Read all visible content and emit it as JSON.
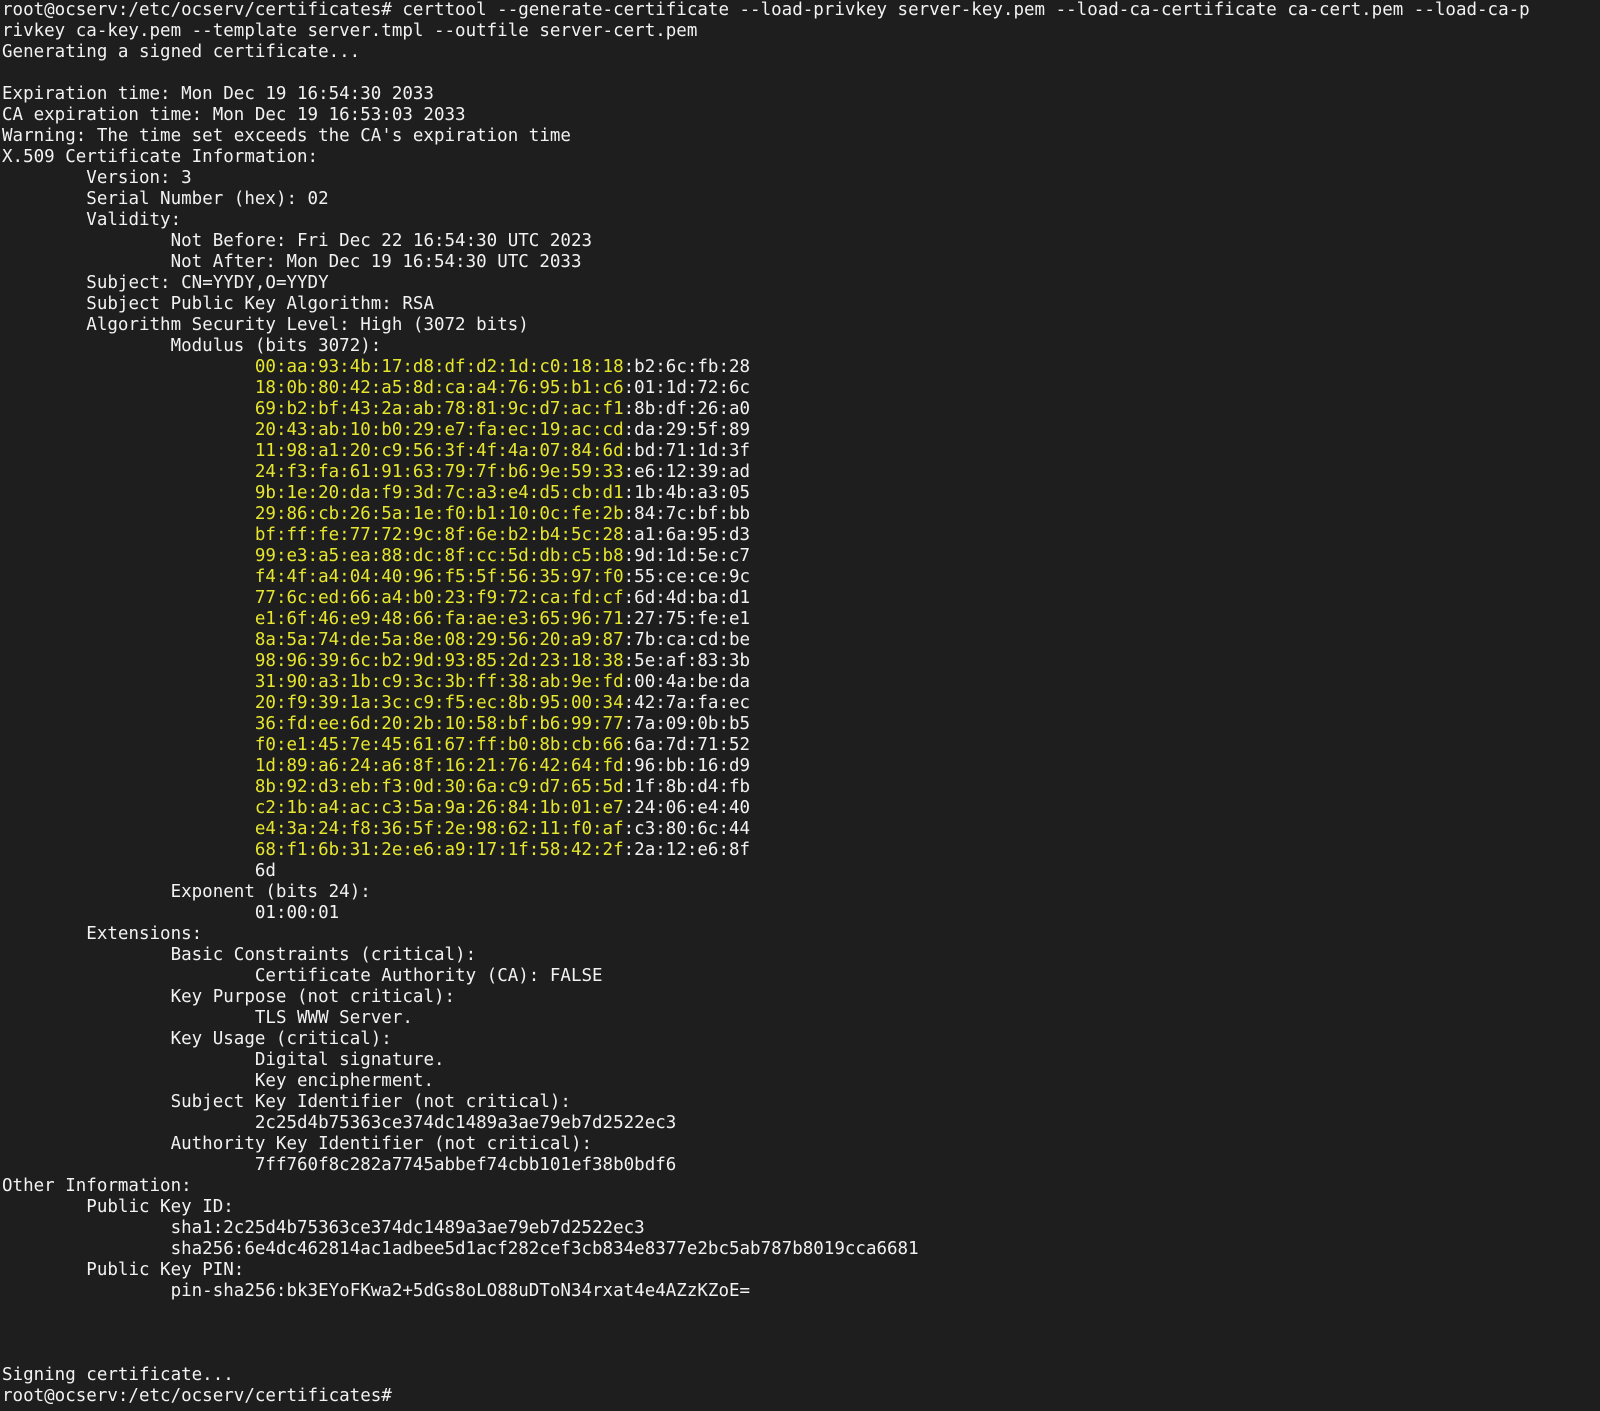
{
  "terminal": {
    "lines": [
      {
        "indent": 0,
        "text": "root@ocserv:/etc/ocserv/certificates# certtool --generate-certificate --load-privkey server-key.pem --load-ca-certificate ca-cert.pem --load-ca-p"
      },
      {
        "indent": 0,
        "text": "rivkey ca-key.pem --template server.tmpl --outfile server-cert.pem"
      },
      {
        "indent": 0,
        "text": "Generating a signed certificate..."
      },
      {
        "indent": 0,
        "text": ""
      },
      {
        "indent": 0,
        "text": "Expiration time: Mon Dec 19 16:54:30 2033"
      },
      {
        "indent": 0,
        "text": "CA expiration time: Mon Dec 19 16:53:03 2033"
      },
      {
        "indent": 0,
        "text": "Warning: The time set exceeds the CA's expiration time"
      },
      {
        "indent": 0,
        "text": "X.509 Certificate Information:"
      },
      {
        "indent": 1,
        "text": "Version: 3"
      },
      {
        "indent": 1,
        "text": "Serial Number (hex): 02"
      },
      {
        "indent": 1,
        "text": "Validity:"
      },
      {
        "indent": 2,
        "text": "Not Before: Fri Dec 22 16:54:30 UTC 2023"
      },
      {
        "indent": 2,
        "text": "Not After: Mon Dec 19 16:54:30 UTC 2033"
      },
      {
        "indent": 1,
        "text": "Subject: CN=YYDY,O=YYDY"
      },
      {
        "indent": 1,
        "text": "Subject Public Key Algorithm: RSA"
      },
      {
        "indent": 1,
        "text": "Algorithm Security Level: High (3072 bits)"
      },
      {
        "indent": 2,
        "text": "Modulus (bits 3072):"
      },
      {
        "indent": 3,
        "hl": "00:aa:93:4b:17:d8:df:d2:1d:c0:18:18",
        "text": ":b2:6c:fb:28"
      },
      {
        "indent": 3,
        "hl": "18:0b:80:42:a5:8d:ca:a4:76:95:b1:c6",
        "text": ":01:1d:72:6c"
      },
      {
        "indent": 3,
        "hl": "69:b2:bf:43:2a:ab:78:81:9c:d7:ac:f1",
        "text": ":8b:df:26:a0"
      },
      {
        "indent": 3,
        "hl": "20:43:ab:10:b0:29:e7:fa:ec:19:ac:cd",
        "text": ":da:29:5f:89"
      },
      {
        "indent": 3,
        "hl": "11:98:a1:20:c9:56:3f:4f:4a:07:84:6d",
        "text": ":bd:71:1d:3f"
      },
      {
        "indent": 3,
        "hl": "24:f3:fa:61:91:63:79:7f:b6:9e:59:33",
        "text": ":e6:12:39:ad"
      },
      {
        "indent": 3,
        "hl": "9b:1e:20:da:f9:3d:7c:a3:e4:d5:cb:d1",
        "text": ":1b:4b:a3:05"
      },
      {
        "indent": 3,
        "hl": "29:86:cb:26:5a:1e:f0:b1:10:0c:fe:2b",
        "text": ":84:7c:bf:bb"
      },
      {
        "indent": 3,
        "hl": "bf:ff:fe:77:72:9c:8f:6e:b2:b4:5c:28",
        "text": ":a1:6a:95:d3"
      },
      {
        "indent": 3,
        "hl": "99:e3:a5:ea:88:dc:8f:cc:5d:db:c5:b8",
        "text": ":9d:1d:5e:c7"
      },
      {
        "indent": 3,
        "hl": "f4:4f:a4:04:40:96:f5:5f:56:35:97:f0",
        "text": ":55:ce:ce:9c"
      },
      {
        "indent": 3,
        "hl": "77:6c:ed:66:a4:b0:23:f9:72:ca:fd:cf",
        "text": ":6d:4d:ba:d1"
      },
      {
        "indent": 3,
        "hl": "e1:6f:46:e9:48:66:fa:ae:e3:65:96:71",
        "text": ":27:75:fe:e1"
      },
      {
        "indent": 3,
        "hl": "8a:5a:74:de:5a:8e:08:29:56:20:a9:87",
        "text": ":7b:ca:cd:be"
      },
      {
        "indent": 3,
        "hl": "98:96:39:6c:b2:9d:93:85:2d:23:18:38",
        "text": ":5e:af:83:3b"
      },
      {
        "indent": 3,
        "hl": "31:90:a3:1b:c9:3c:3b:ff:38:ab:9e:fd",
        "text": ":00:4a:be:da"
      },
      {
        "indent": 3,
        "hl": "20:f9:39:1a:3c:c9:f5:ec:8b:95:00:34",
        "text": ":42:7a:fa:ec"
      },
      {
        "indent": 3,
        "hl": "36:fd:ee:6d:20:2b:10:58:bf:b6:99:77",
        "text": ":7a:09:0b:b5"
      },
      {
        "indent": 3,
        "hl": "f0:e1:45:7e:45:61:67:ff:b0:8b:cb:66",
        "text": ":6a:7d:71:52"
      },
      {
        "indent": 3,
        "hl": "1d:89:a6:24:a6:8f:16:21:76:42:64:fd",
        "text": ":96:bb:16:d9"
      },
      {
        "indent": 3,
        "hl": "8b:92:d3:eb:f3:0d:30:6a:c9:d7:65:5d",
        "text": ":1f:8b:d4:fb"
      },
      {
        "indent": 3,
        "hl": "c2:1b:a4:ac:c3:5a:9a:26:84:1b:01:e7",
        "text": ":24:06:e4:40"
      },
      {
        "indent": 3,
        "hl": "e4:3a:24:f8:36:5f:2e:98:62:11:f0:af",
        "text": ":c3:80:6c:44"
      },
      {
        "indent": 3,
        "hl": "68:f1:6b:31:2e:e6:a9:17:1f:58:42:2f",
        "text": ":2a:12:e6:8f"
      },
      {
        "indent": 3,
        "text": "6d"
      },
      {
        "indent": 2,
        "text": "Exponent (bits 24):"
      },
      {
        "indent": 3,
        "text": "01:00:01"
      },
      {
        "indent": 1,
        "text": "Extensions:"
      },
      {
        "indent": 2,
        "text": "Basic Constraints (critical):"
      },
      {
        "indent": 3,
        "text": "Certificate Authority (CA): FALSE"
      },
      {
        "indent": 2,
        "text": "Key Purpose (not critical):"
      },
      {
        "indent": 3,
        "text": "TLS WWW Server."
      },
      {
        "indent": 2,
        "text": "Key Usage (critical):"
      },
      {
        "indent": 3,
        "text": "Digital signature."
      },
      {
        "indent": 3,
        "text": "Key encipherment."
      },
      {
        "indent": 2,
        "text": "Subject Key Identifier (not critical):"
      },
      {
        "indent": 3,
        "text": "2c25d4b75363ce374dc1489a3ae79eb7d2522ec3"
      },
      {
        "indent": 2,
        "text": "Authority Key Identifier (not critical):"
      },
      {
        "indent": 3,
        "text": "7ff760f8c282a7745abbef74cbb101ef38b0bdf6"
      },
      {
        "indent": 0,
        "text": "Other Information:"
      },
      {
        "indent": 1,
        "text": "Public Key ID:"
      },
      {
        "indent": 2,
        "text": "sha1:2c25d4b75363ce374dc1489a3ae79eb7d2522ec3"
      },
      {
        "indent": 2,
        "text": "sha256:6e4dc462814ac1adbee5d1acf282cef3cb834e8377e2bc5ab787b8019cca6681"
      },
      {
        "indent": 1,
        "text": "Public Key PIN:"
      },
      {
        "indent": 2,
        "text": "pin-sha256:bk3EYoFKwa2+5dGs8oLO88uDToN34rxat4e4AZzKZoE="
      },
      {
        "indent": 0,
        "text": ""
      },
      {
        "indent": 0,
        "text": ""
      },
      {
        "indent": 0,
        "text": ""
      },
      {
        "indent": 0,
        "text": "Signing certificate..."
      },
      {
        "indent": 0,
        "text": "root@ocserv:/etc/ocserv/certificates#"
      }
    ]
  },
  "colors": {
    "background": "#1e1e1e",
    "foreground": "#f2f2f2",
    "highlight": "#e6e62e"
  }
}
